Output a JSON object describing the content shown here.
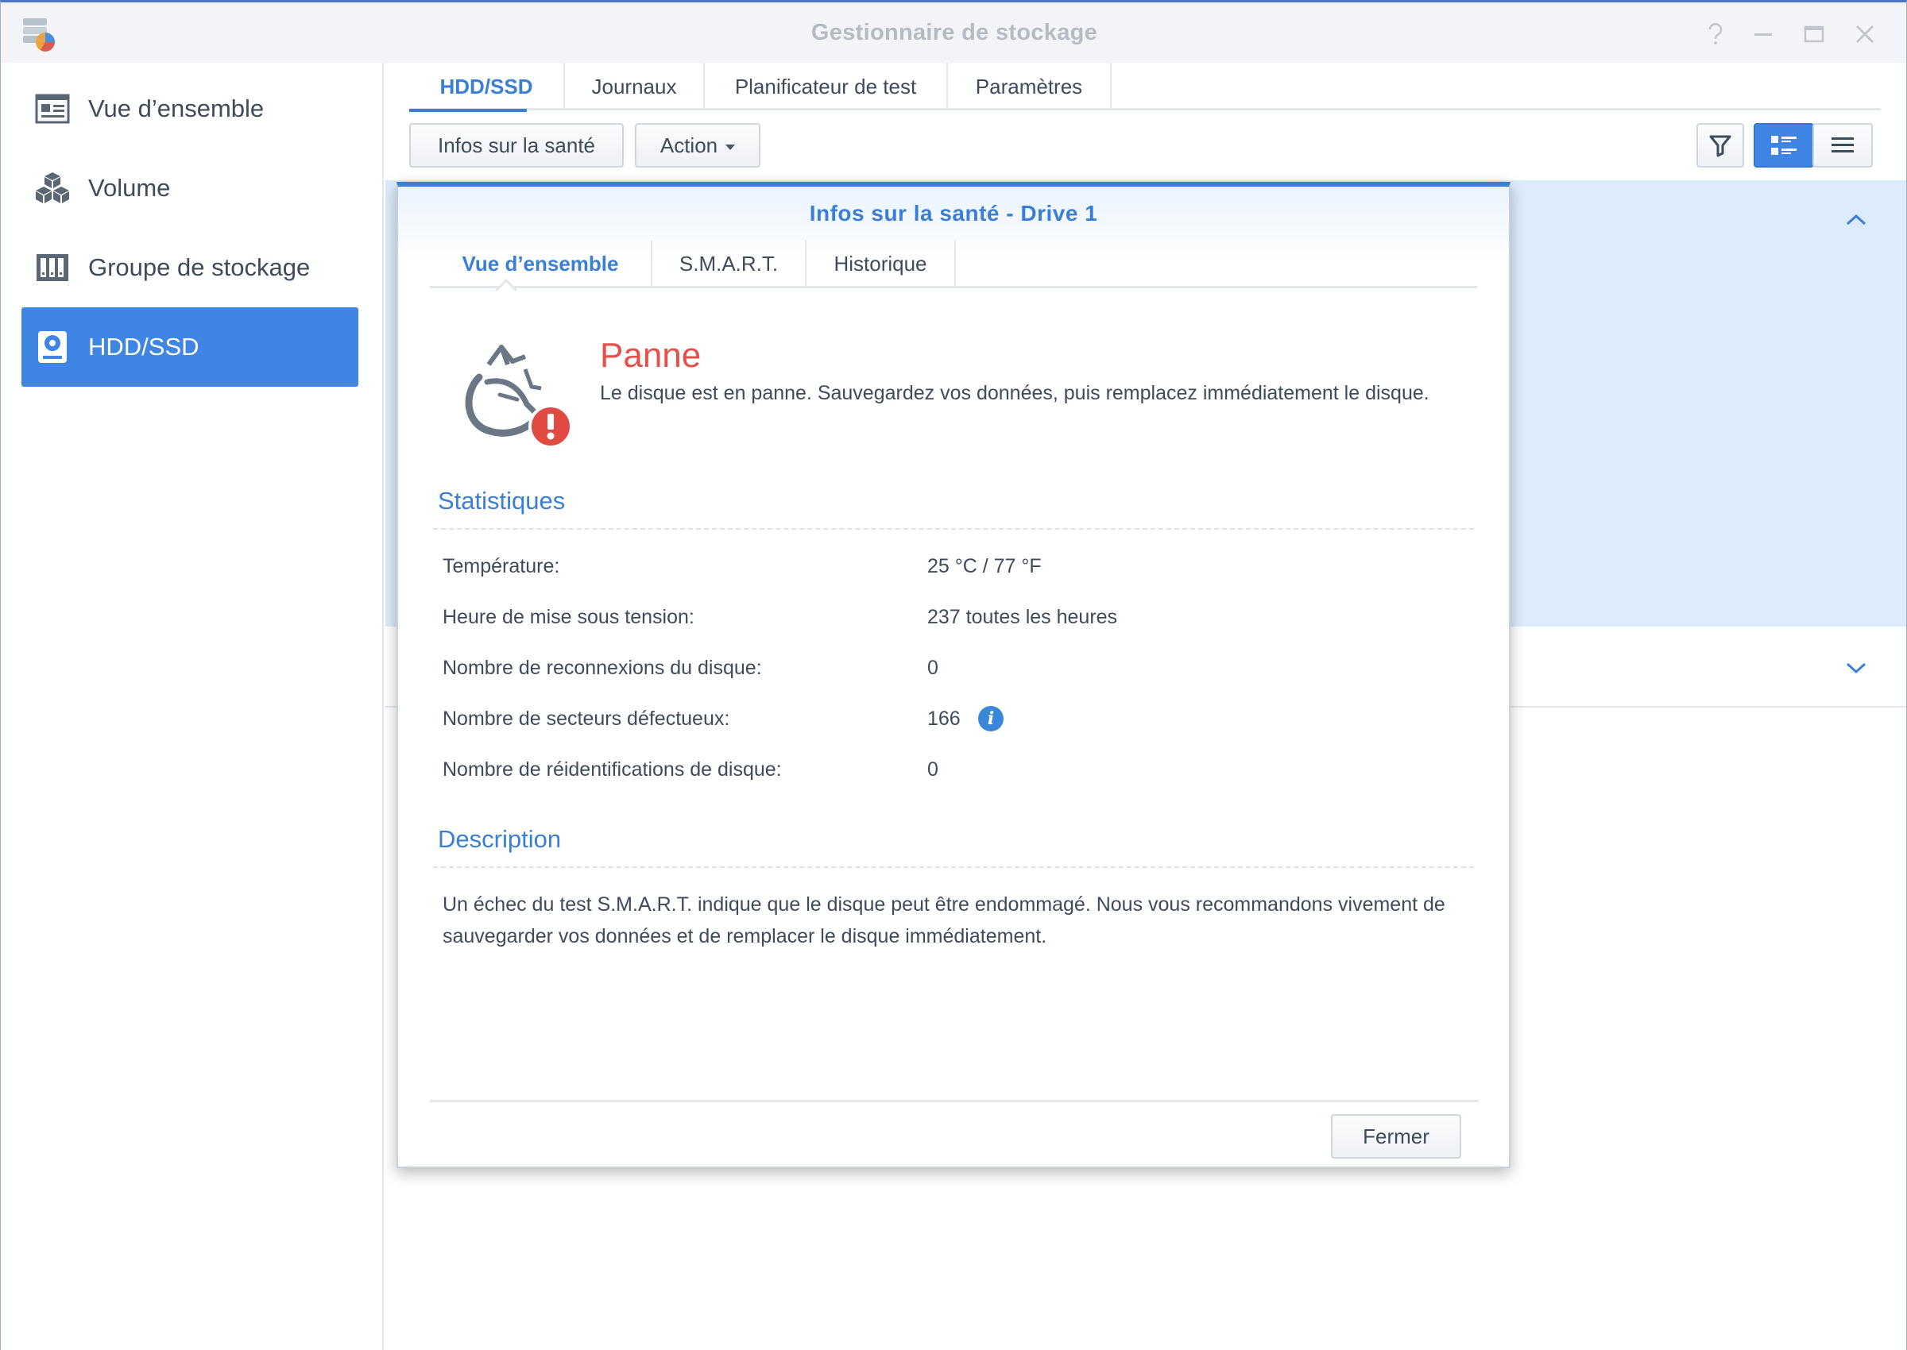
{
  "window": {
    "title": "Gestionnaire de stockage",
    "controls": [
      "help-icon",
      "minimize-icon",
      "maximize-icon",
      "close-icon"
    ]
  },
  "sidebar": {
    "items": [
      {
        "label": "Vue d’ensemble",
        "icon": "overview-icon"
      },
      {
        "label": "Volume",
        "icon": "volume-cubes-icon"
      },
      {
        "label": "Groupe de stockage",
        "icon": "storage-pool-icon"
      },
      {
        "label": "HDD/SSD",
        "icon": "disk-icon",
        "active": true
      }
    ]
  },
  "main": {
    "tabs": [
      "HDD/SSD",
      "Journaux",
      "Planificateur de test",
      "Paramètres"
    ],
    "active_tab": "HDD/SSD",
    "toolbar": {
      "health_button": "Infos sur la santé",
      "action_button": "Action"
    }
  },
  "dialog": {
    "title": "Infos sur la santé - Drive 1",
    "tabs": [
      "Vue d’ensemble",
      "S.M.A.R.T.",
      "Historique"
    ],
    "active_tab": "Vue d’ensemble",
    "status": {
      "title": "Panne",
      "description": "Le disque est en panne. Sauvegardez vos données, puis remplacez immédiatement le disque."
    },
    "statistics_title": "Statistiques",
    "stats": [
      {
        "label": "Température:",
        "value": "25 °C / 77 °F"
      },
      {
        "label": "Heure de mise sous tension:",
        "value": "237 toutes les heures"
      },
      {
        "label": "Nombre de reconnexions du disque:",
        "value": "0"
      },
      {
        "label": "Nombre de secteurs défectueux:",
        "value": "166"
      },
      {
        "label": "Nombre de réidentifications de disque:",
        "value": "0"
      }
    ],
    "description_title": "Description",
    "description_text": "Un échec du test S.M.A.R.T. indique que le disque peut être endommagé. Nous vous recommandons vivement de sauvegarder vos données et de remplacer le disque immédiatement.",
    "close_button": "Fermer"
  },
  "colors": {
    "accent": "#3a7fd5",
    "active_sidebar": "#3f85e3",
    "error": "#e4514b",
    "list_highlight": "#ddecfb"
  }
}
